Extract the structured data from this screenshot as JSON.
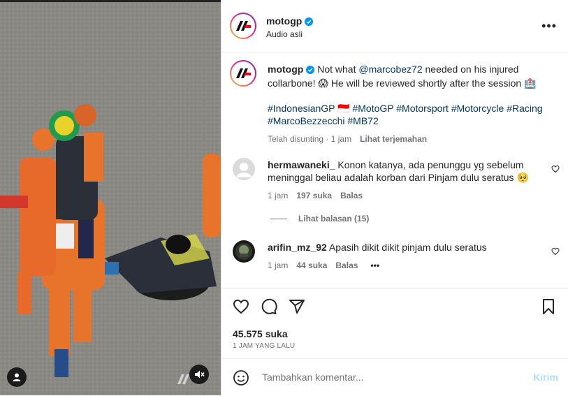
{
  "header": {
    "username": "motogp",
    "subtitle": "Audio asli"
  },
  "caption": {
    "username": "motogp",
    "text_before": "Not what ",
    "mention": "@marcobez72",
    "text_after": " needed on his injured collarbone! 😱 He will be reviewed shortly after the session 🏥",
    "hashtags_line1": "#IndonesianGP 🇮🇩 #MotoGP #Motorsport #Motorcycle #Racing",
    "hashtags_line2": "#MarcoBezzecchi #MB72",
    "edited": "Telah disunting · 1 jam",
    "translate": "Lihat terjemahan"
  },
  "comments": [
    {
      "username": "hermawaneki_",
      "text": "Konon katanya, ada penunggu yg sebelum meninggal beliau adalah korban dari Pinjam dulu seratus 🥺",
      "time": "1 jam",
      "likes": "197 suka",
      "reply": "Balas",
      "view_replies": "Lihat balasan (15)"
    },
    {
      "username": "arifin_mz_92",
      "text": "Apasih dikit dikit pinjam dulu seratus",
      "time": "1 jam",
      "likes": "44 suka",
      "reply": "Balas",
      "more": "•••"
    }
  ],
  "post": {
    "likes": "45.575 suka",
    "timestamp": "1 JAM YANG LALU"
  },
  "composer": {
    "placeholder": "Tambahkan komentar...",
    "post_label": "Kirim"
  },
  "icons": {
    "like": "heart-icon",
    "comment": "comment-icon",
    "share": "share-icon",
    "save": "bookmark-icon",
    "emoji": "emoji-icon",
    "mute": "muted-speaker-icon",
    "account": "user-icon"
  },
  "colors": {
    "verified": "#0095f6",
    "link": "#00376b",
    "muted_text": "#737373",
    "post_button": "#b3dbff",
    "brand_red": "#e8001c"
  }
}
